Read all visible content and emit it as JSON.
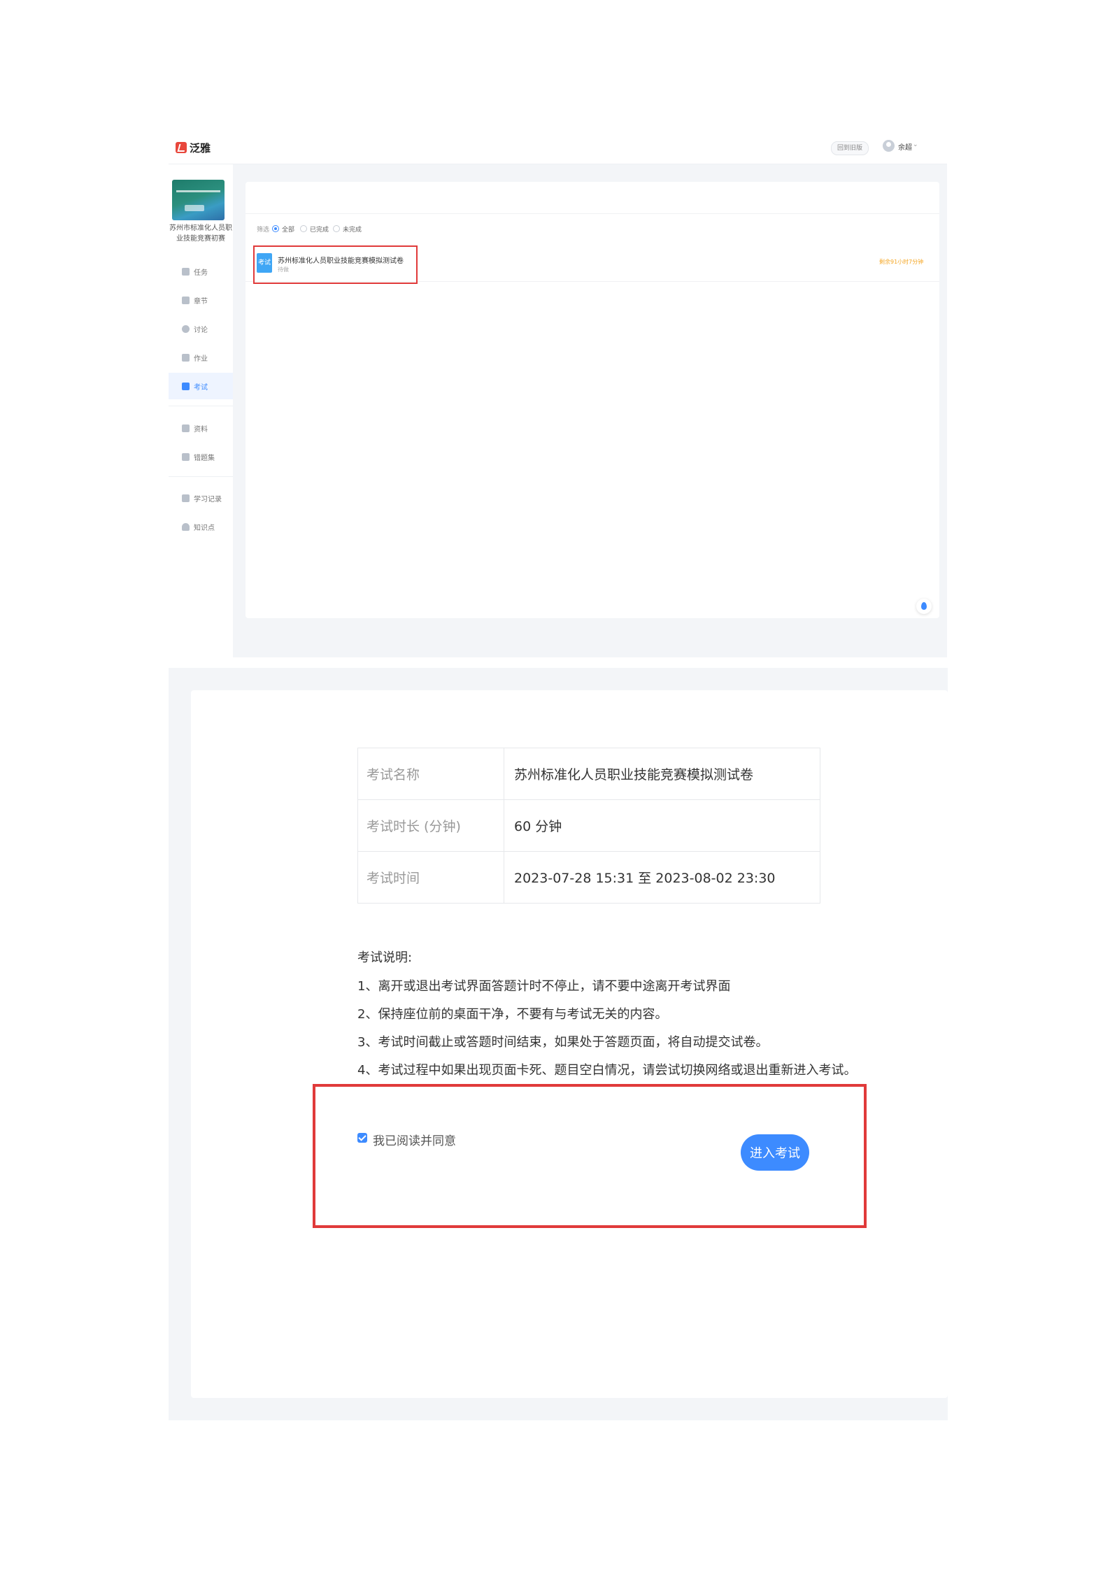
{
  "top": {
    "brand": "泛雅",
    "back_old_label": "回到旧版",
    "user_name": "余超",
    "sidebar": {
      "course_title": "苏州市标准化人员职业技能竞赛初赛",
      "items": [
        {
          "label": "任务"
        },
        {
          "label": "章节"
        },
        {
          "label": "讨论"
        },
        {
          "label": "作业"
        },
        {
          "label": "考试"
        },
        {
          "label": "资料"
        },
        {
          "label": "错题集"
        },
        {
          "label": "学习记录"
        },
        {
          "label": "知识点"
        }
      ]
    },
    "filter": {
      "label": "筛选",
      "options": [
        "全部",
        "已完成",
        "未完成"
      ],
      "selected": "全部"
    },
    "exam_item": {
      "tag": "考试",
      "title": "苏州标准化人员职业技能竞赛模拟测试卷",
      "status": "待做",
      "deadline": "剩余91小时7分钟"
    }
  },
  "detail": {
    "rows": [
      {
        "key": "考试名称",
        "value": "苏州标准化人员职业技能竞赛模拟测试卷"
      },
      {
        "key": "考试时长 (分钟)",
        "value": "60 分钟"
      },
      {
        "key": "考试时间",
        "value": "2023-07-28 15:31 至 2023-08-02 23:30"
      }
    ],
    "notes_title": "考试说明:",
    "notes": [
      "1、离开或退出考试界面答题计时不停止，请不要中途离开考试界面",
      "2、保持座位前的桌面干净，不要有与考试无关的内容。",
      "3、考试时间截止或答题时间结束，如果处于答题页面，将自动提交试卷。",
      "4、考试过程中如果出现页面卡死、题目空白情况，请尝试切换网络或退出重新进入考试。"
    ],
    "agree_label": "我已阅读并同意",
    "agree_checked": true,
    "enter_button": "进入考试"
  },
  "colors": {
    "accent": "#3d8bff",
    "highlight": "#e03a3a",
    "warning": "#f5a623"
  }
}
